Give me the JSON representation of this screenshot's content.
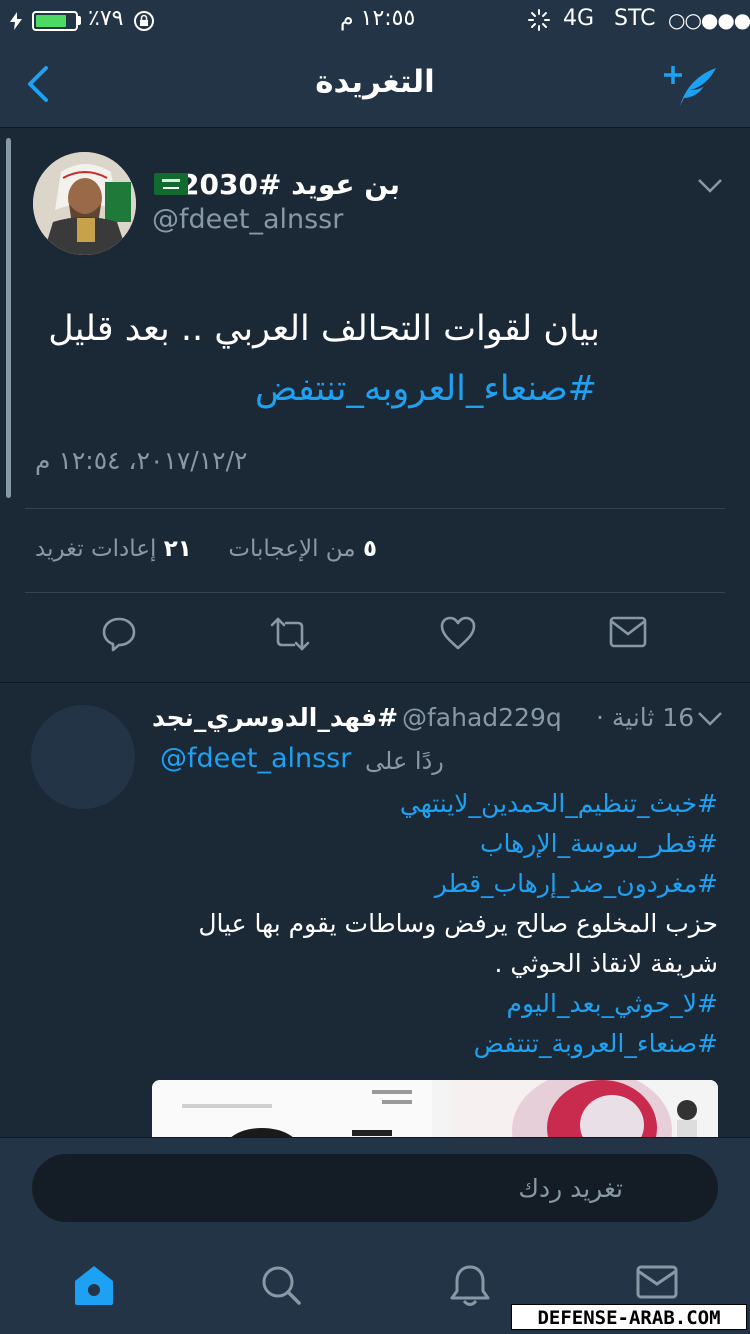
{
  "status_bar": {
    "battery_text": "٪٧٩",
    "time": "١٢:٥٥ م",
    "network": "4G",
    "carrier": "STC",
    "signal": "○○●●●",
    "battery_level": 0.79
  },
  "nav": {
    "title": "التغريدة"
  },
  "tweet": {
    "author_name": "بن عويد #2030",
    "author_handle": "@fdeet_alnssr",
    "text": "بيان لقوات التحالف العربي .. بعد قليل",
    "hashtag": "#صنعاء_العروبه_تنتفض",
    "timestamp": "٢٠١٧/١٢/٢، ١٢:٥٤ م",
    "likes_count": "٥",
    "likes_label": "من الإعجابات",
    "retweets_count": "٢١",
    "retweets_label": "إعادات تغريد"
  },
  "reply": {
    "time": "16 ثانية ·",
    "handle": "@fahad229q",
    "name": "#فهد_الدوسري_نجد",
    "replying_to_label": "ردًا على",
    "replying_to_handle": "@fdeet_alnssr",
    "lines": [
      {
        "text": "#خبث_تنظيم_الحمدين_لاينتهي",
        "kind": "link"
      },
      {
        "text": "#قطر_سوسة_الإرهاب",
        "kind": "link"
      },
      {
        "text": "#مغردون_ضد_إرهاب_قطر",
        "kind": "link"
      },
      {
        "text": "حزب المخلوع صالح يرفض وساطات يقوم بها عيال",
        "kind": "text"
      },
      {
        "text": "شريفة لانقاذ الحوثي .",
        "kind": "text"
      },
      {
        "text": "#لا_حوثي_بعد_اليوم",
        "kind": "link"
      },
      {
        "text": "#صنعاء_العروبة_تنتفض",
        "kind": "link"
      }
    ]
  },
  "composer": {
    "placeholder": "تغريد ردك"
  },
  "tabs": [
    "home-icon",
    "search-icon",
    "notifications-icon",
    "messages-icon"
  ],
  "watermark": "DEFENSE-ARAB.COM",
  "colors": {
    "accent": "#1da1f2",
    "background": "#141d26",
    "card": "#1b2836",
    "bar": "#243447",
    "muted": "#8899a6"
  }
}
